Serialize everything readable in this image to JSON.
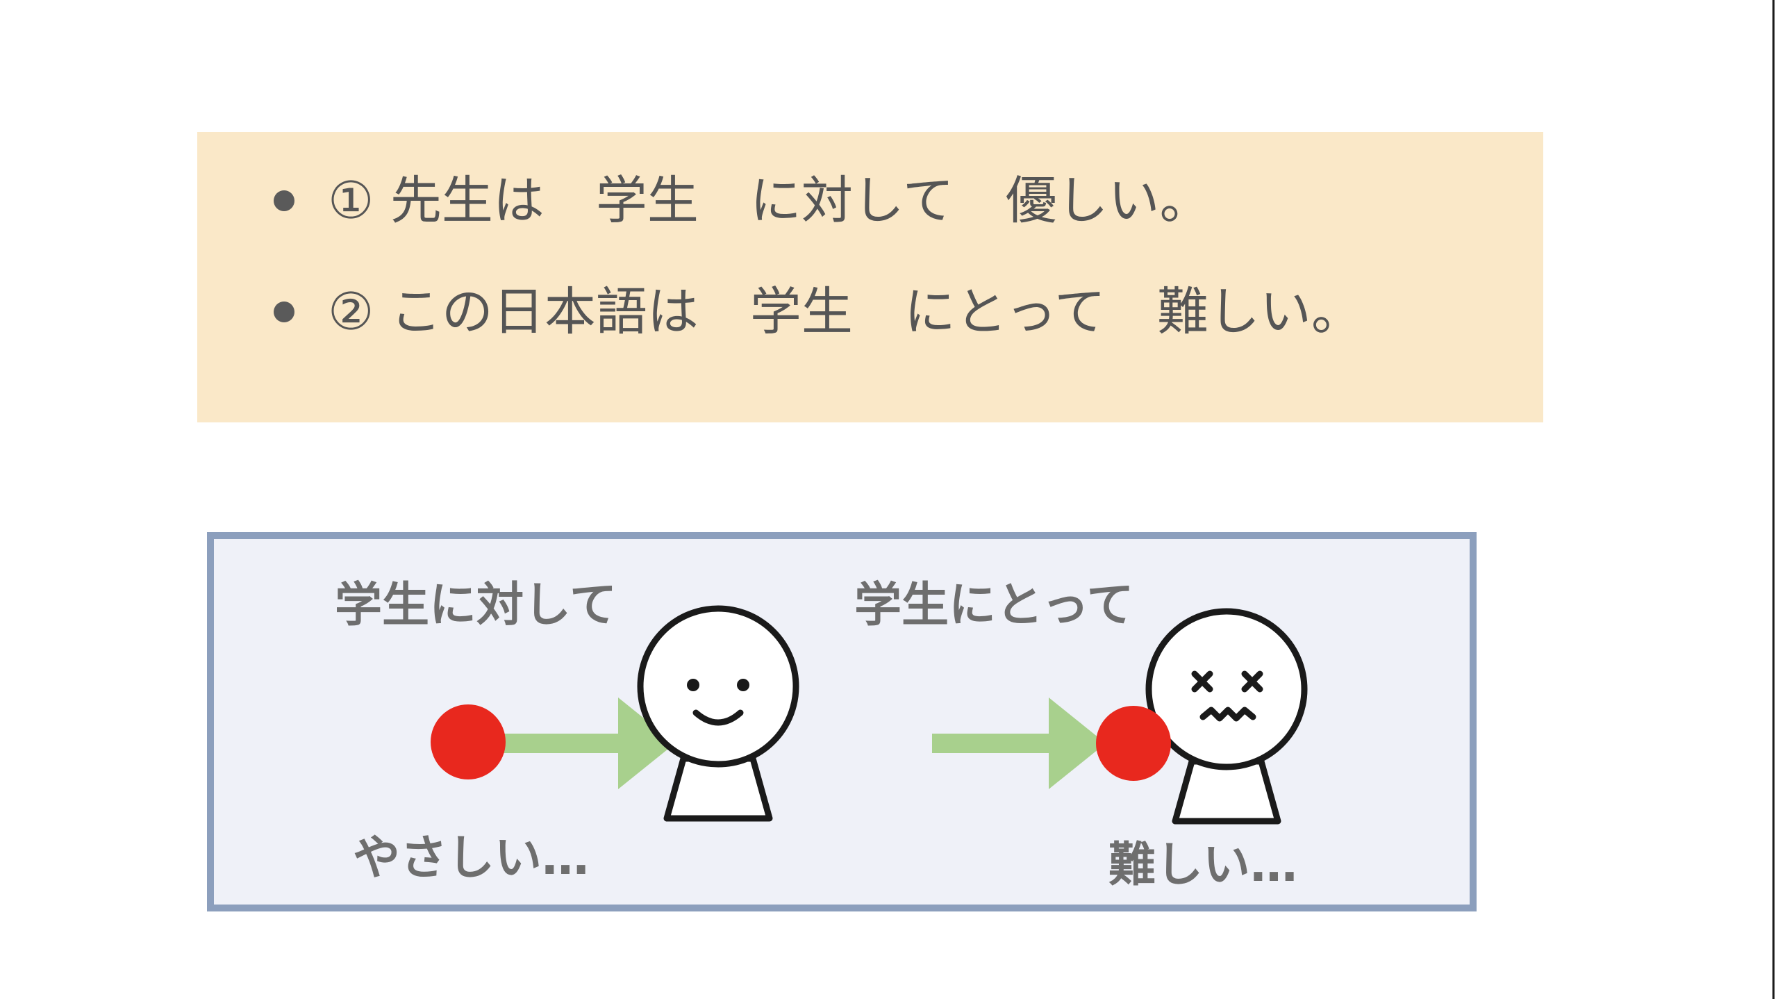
{
  "examples": [
    {
      "num": "①",
      "text": "先生は　学生　に対して　優しい。"
    },
    {
      "num": "②",
      "text": "この日本語は　学生　にとって　難しい。"
    }
  ],
  "diagram": {
    "left": {
      "heading": "学生に対して",
      "caption": "やさしい…"
    },
    "right": {
      "heading": "学生にとって",
      "caption": "難しい…"
    }
  },
  "colors": {
    "example_bg": "#fae8c8",
    "frame_border": "#8c9fbd",
    "frame_bg": "#eff1f8",
    "ball": "#e8281e",
    "arrow": "#a8d08d"
  }
}
